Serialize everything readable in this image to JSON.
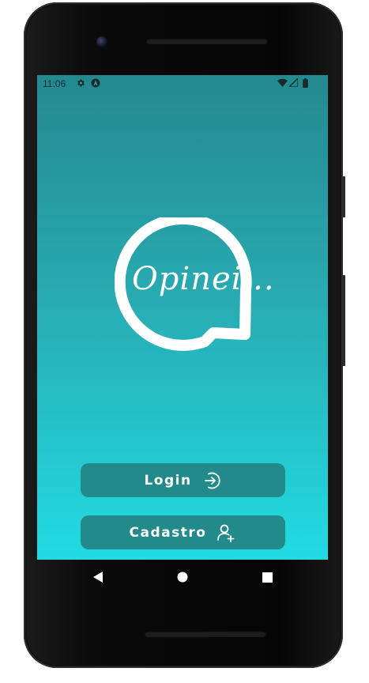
{
  "status_bar": {
    "time": "11:06",
    "icons": [
      "gear-icon",
      "a-badge-icon",
      "wifi-icon",
      "signal-icon",
      "battery-icon"
    ]
  },
  "app": {
    "logo_text": "Opinei...",
    "colors": {
      "gradient_top": "#23898e",
      "gradient_bottom": "#21dbe2",
      "button": "#238a8c",
      "text": "#ffffff"
    }
  },
  "buttons": {
    "login_label": "Login",
    "login_icon": "login-arrow-icon",
    "cadastro_label": "Cadastro",
    "cadastro_icon": "add-user-icon"
  },
  "nav_bar": {
    "icons": [
      "back-icon",
      "home-icon",
      "recents-icon"
    ]
  }
}
